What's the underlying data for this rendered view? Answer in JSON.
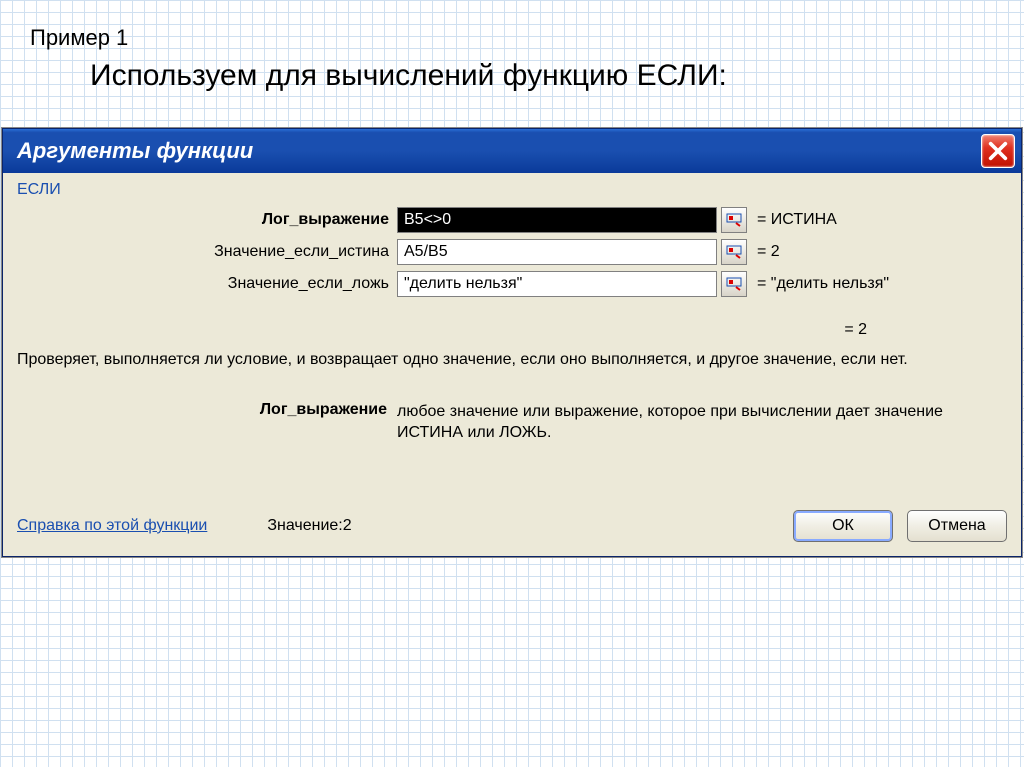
{
  "header": {
    "example_label": "Пример 1",
    "subtitle": "Используем для вычислений функцию ЕСЛИ:"
  },
  "dialog": {
    "title": "Аргументы функции",
    "function_name": "ЕСЛИ",
    "args": [
      {
        "label": "Лог_выражение",
        "value": "B5<>0",
        "result": "= ИСТИНА",
        "bold": true,
        "dark": true
      },
      {
        "label": "Значение_если_истина",
        "value": "A5/B5",
        "result": "= 2",
        "bold": false,
        "dark": false
      },
      {
        "label": "Значение_если_ложь",
        "value": "\"делить нельзя\"",
        "result": "= \"делить нельзя\"",
        "bold": false,
        "dark": false
      }
    ],
    "overall_result": "= 2",
    "description": "Проверяет, выполняется ли условие, и возвращает одно значение, если оно выполняется, и другое значение, если нет.",
    "arg_help": {
      "label": "Лог_выражение",
      "text": "любое значение или выражение, которое при вычислении дает значение ИСТИНА или ЛОЖЬ."
    },
    "footer": {
      "help_link": "Справка по этой функции",
      "value_prefix": "Значение:",
      "value": "2",
      "ok": "ОК",
      "cancel": "Отмена"
    }
  }
}
